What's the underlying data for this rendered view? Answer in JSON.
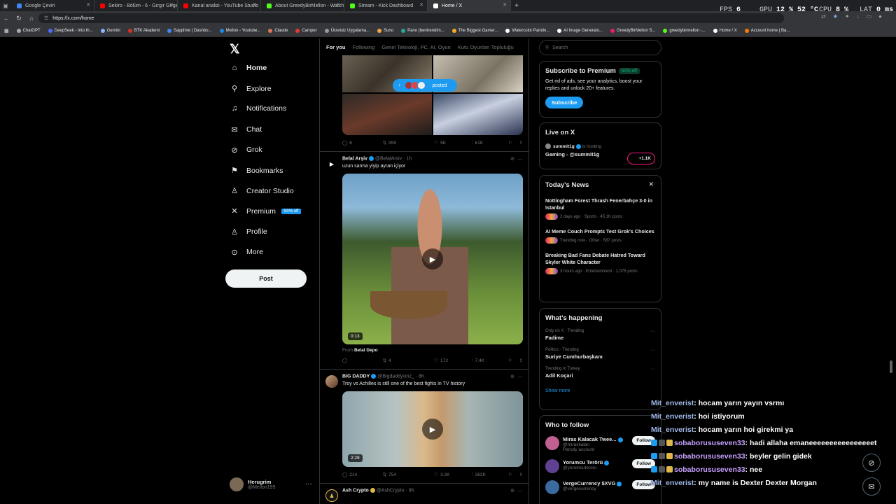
{
  "browser": {
    "tabs": [
      {
        "title": "Google Çeviri",
        "color": "#4285f4"
      },
      {
        "title": "Sekiro - Bölüm - 6 - Gırgır Gırge - YouTube",
        "color": "#ff0000"
      },
      {
        "title": "Kanal analizi - YouTube Studio",
        "color": "#ff0000"
      },
      {
        "title": "About GreedyBirMellon - Watch Live",
        "color": "#53fc18"
      },
      {
        "title": "Stream - Kick Dashboard",
        "color": "#53fc18"
      },
      {
        "title": "Home / X",
        "color": "#ffffff"
      }
    ],
    "new_tab": "+",
    "url": "https://x.com/home",
    "bookmarks": [
      {
        "label": "ChatGPT",
        "color": "#aaaaaa"
      },
      {
        "label": "DeepSeek - Into th...",
        "color": "#4d6bfe"
      },
      {
        "label": "Gemini",
        "color": "#8ab4f8"
      },
      {
        "label": "BTK Akademi",
        "color": "#d93025"
      },
      {
        "label": "Sapphire | Dashbo...",
        "color": "#4285f4"
      },
      {
        "label": "Mellon - Youtube...",
        "color": "#1e88e5"
      },
      {
        "label": "Claude",
        "color": "#d97757"
      },
      {
        "label": "Camper",
        "color": "#e53935"
      },
      {
        "label": "Ücretsiz Uygulama...",
        "color": "#999999"
      },
      {
        "label": "Suno",
        "color": "#f4a742"
      },
      {
        "label": "Pano (bentrendim...",
        "color": "#26a69a"
      },
      {
        "label": "The Biggest Gamer...",
        "color": "#f9a825"
      },
      {
        "label": "Watercolor Paintin...",
        "color": "#ffffff"
      },
      {
        "label": "AI Image Generato...",
        "color": "#ffffff"
      },
      {
        "label": "GreedyBirMellon S...",
        "color": "#e91e63"
      },
      {
        "label": "greedybirmellon -...",
        "color": "#53fc18"
      },
      {
        "label": "Home / X",
        "color": "#ffffff"
      },
      {
        "label": "Account home | Ba...",
        "color": "#f57c00"
      }
    ]
  },
  "overlay": {
    "fps_label": "FPS",
    "fps_value": "6",
    "gpu_label": "GPU",
    "gpu_value": "12 %",
    "gpu_temp": "52 °C",
    "cpu_label": "CPU",
    "cpu_value": "8 %",
    "lat_label": "LAT",
    "lat_value": "0 ms"
  },
  "nav": {
    "items": [
      {
        "label": "Home",
        "icon": "home-icon",
        "glyph": "⌂"
      },
      {
        "label": "Explore",
        "icon": "search-icon",
        "glyph": "⚲"
      },
      {
        "label": "Notifications",
        "icon": "bell-icon",
        "glyph": "♫"
      },
      {
        "label": "Chat",
        "icon": "mail-icon",
        "glyph": "✉"
      },
      {
        "label": "Grok",
        "icon": "grok-icon",
        "glyph": "⊘"
      },
      {
        "label": "Bookmarks",
        "icon": "bookmark-icon",
        "glyph": "⚑"
      },
      {
        "label": "Creator Studio",
        "icon": "creator-icon",
        "glyph": "♙"
      },
      {
        "label": "Premium",
        "icon": "x-premium-icon",
        "glyph": "✕"
      },
      {
        "label": "Profile",
        "icon": "profile-icon",
        "glyph": "♙"
      },
      {
        "label": "More",
        "icon": "more-circle-icon",
        "glyph": "⊙"
      }
    ],
    "premium_badge": "50% off",
    "post_button": "Post",
    "account": {
      "name": "Herugrim",
      "handle": "@Mellon199"
    }
  },
  "feed": {
    "tabs": [
      "For you",
      "Following",
      "Genel Teknoloji, PC, AI, Oyun",
      "Kutu Oyunları Topluluğu"
    ],
    "posted_pill": "posted",
    "posts": [
      {
        "actions": {
          "replies": "6",
          "reposts": "959",
          "likes": "5K",
          "views": "61K"
        }
      },
      {
        "name": "Belal Arşiv",
        "handle": "@BelalArsiv",
        "time": "· 1h",
        "text": "uzun sarma yiyip ayran içiyor",
        "duration": "0:13",
        "from_label": "From",
        "from_name": "Belal Depo",
        "actions": {
          "replies": "",
          "reposts": "4",
          "likes": "172",
          "views": "7.4K"
        }
      },
      {
        "name": "BIG DADDY",
        "handle": "@Bigdaddyvinz_",
        "time": "· 8h",
        "text": "Troy vs Achilles is still one of the best fights in TV history",
        "duration": "2:29",
        "actions": {
          "replies": "214",
          "reposts": "754",
          "likes": "3.3K",
          "views": "262K"
        }
      },
      {
        "name": "Ash Crypto",
        "handle": "@AshCrypto",
        "time": "· 9h"
      }
    ]
  },
  "sidebar": {
    "search_placeholder": "Search",
    "premium": {
      "title": "Subscribe to Premium",
      "badge": "50% off",
      "text": "Get rid of ads, see your analytics, boost your replies and unlock 20+ features.",
      "button": "Subscribe"
    },
    "live": {
      "title": "Live on X",
      "host": "summit1g",
      "host_status": "is hosting",
      "stream_title": "Gaming - @summit1g",
      "viewers": "+1.1K"
    },
    "news": {
      "title": "Today's News",
      "items": [
        {
          "title": "Nottingham Forest Thrash Fenerbahçe 3-0 in Istanbul",
          "meta": "2 days ago · Sports · 45.1K posts"
        },
        {
          "title": "AI Meme Couch Prompts Test Grok's Choices",
          "meta": "Trending now · Other · 587 posts"
        },
        {
          "title": "Breaking Bad Fans Debate Hatred Toward Skyler White Character",
          "meta": "3 hours ago · Entertainment · 1,075 posts"
        }
      ]
    },
    "happening": {
      "title": "What's happening",
      "items": [
        {
          "context": "Only on X · Trending",
          "name": "Fadime"
        },
        {
          "context": "Politics · Trending",
          "name": "Suriye Cumhurbaşkanı"
        },
        {
          "context": "Trending in Turkey",
          "name": "Adil Koçari"
        }
      ],
      "show_more": "Show more"
    },
    "who_to_follow": {
      "title": "Who to follow",
      "follow_label": "Follow",
      "items": [
        {
          "name": "Miras Kalacak Twee...",
          "handle": "@miraskalan",
          "note": "Parody account",
          "color": "#c06090"
        },
        {
          "name": "Yorumcu Terörü",
          "handle": "@yorumcuteroru",
          "note": "",
          "color": "#604090"
        },
        {
          "name": "VergeCurrency $XVG",
          "handle": "@vergecurrency",
          "note": "",
          "color": "#3a6aa0"
        }
      ]
    }
  },
  "chat": {
    "lines": [
      {
        "user": "Mit_enverist",
        "msg": ": hocam yarın yayın vsrmı",
        "style": "u"
      },
      {
        "user": "Mit_enverist",
        "msg": ": hoi istiyorum",
        "style": "u"
      },
      {
        "user": "Mit_enverist",
        "msg": ": hocam yarın hoi girekmi ya",
        "style": "u"
      },
      {
        "user": "sobaborususeven33",
        "msg": ": hadi allaha emaneeeeeeeeeeeeeeeet",
        "style": "u2"
      },
      {
        "user": "sobaborususeven33",
        "msg": ": beyler gelin gidek",
        "style": "u2"
      },
      {
        "user": "sobaborususeven33",
        "msg": ": nee",
        "style": "u2"
      },
      {
        "user": "Mit_enverist",
        "msg": ": my name is Dexter Dexter Morgan",
        "style": "u"
      }
    ]
  }
}
